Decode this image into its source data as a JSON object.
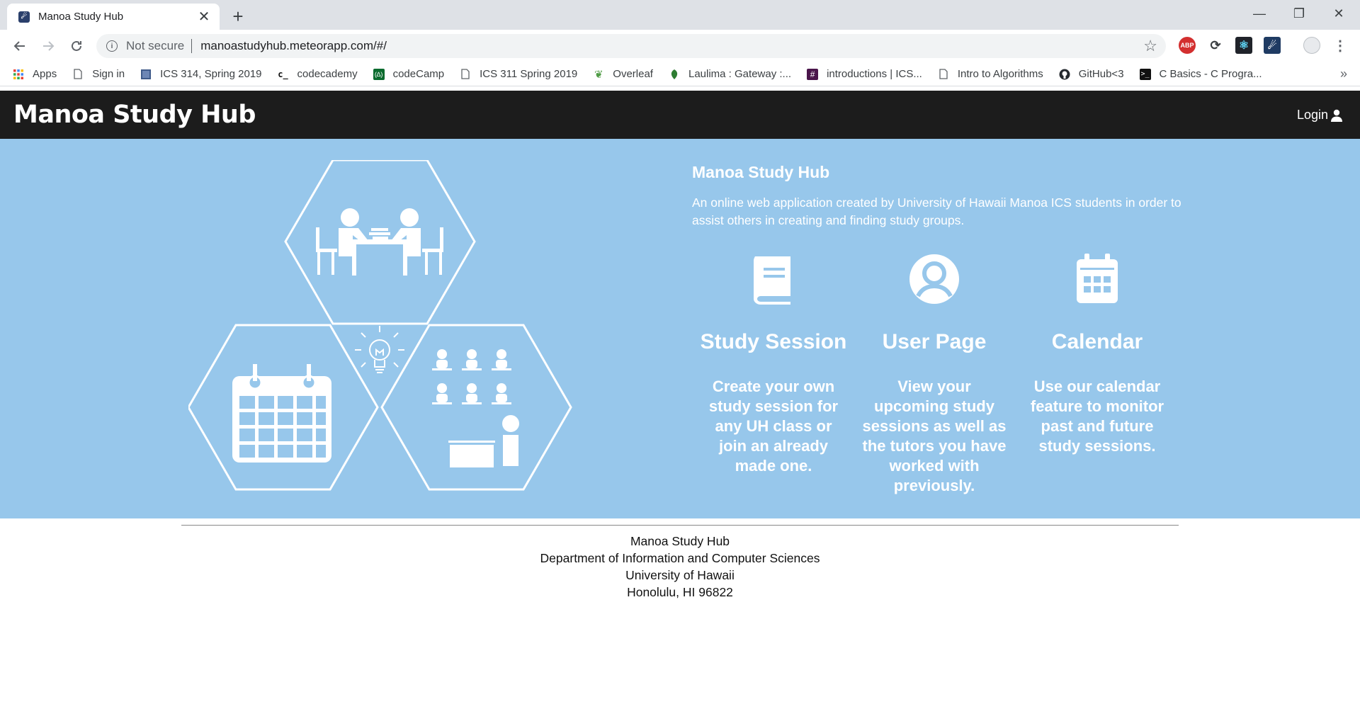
{
  "browser": {
    "tab_title": "Manoa Study Hub",
    "new_tab": "+",
    "close": "✕",
    "minimize": "—",
    "restore": "❐",
    "window_close": "✕",
    "security_label": "Not secure",
    "url": "manoastudyhub.meteorapp.com/#/",
    "bookmarks": [
      {
        "label": "Apps",
        "icon": "apps-grid-icon"
      },
      {
        "label": "Sign in",
        "icon": "page-icon"
      },
      {
        "label": "ICS 314, Spring 2019",
        "icon": "square-icon"
      },
      {
        "label": "codecademy",
        "icon": "codecademy-icon"
      },
      {
        "label": "codeCamp",
        "icon": "codecamp-icon"
      },
      {
        "label": "ICS 311 Spring 2019",
        "icon": "page-icon"
      },
      {
        "label": "Overleaf",
        "icon": "overleaf-icon"
      },
      {
        "label": "Laulima : Gateway :...",
        "icon": "leaf-icon"
      },
      {
        "label": "introductions | ICS...",
        "icon": "slack-icon"
      },
      {
        "label": "Intro to Algorithms",
        "icon": "page-icon"
      },
      {
        "label": "GitHub<3",
        "icon": "github-icon"
      },
      {
        "label": "C Basics - C Progra...",
        "icon": "terminal-icon"
      }
    ],
    "bookmarks_more": "»"
  },
  "site": {
    "brand": "Manoa Study Hub",
    "login": "Login"
  },
  "hero": {
    "title": "Manoa Study Hub",
    "description": "An online web application created by University of Hawaii Manoa ICS students in order to assist others in creating and finding study groups.",
    "features": [
      {
        "title": "Study Session",
        "text": "Create your own study session for any UH class or join an already made one.",
        "icon": "book-icon"
      },
      {
        "title": "User Page",
        "text": "View your upcoming study sessions as well as the tutors you have worked with previously.",
        "icon": "user-circle-icon"
      },
      {
        "title": "Calendar",
        "text": "Use our calendar feature to monitor past and future study sessions.",
        "icon": "calendar-icon"
      }
    ]
  },
  "footer": {
    "line1": "Manoa Study Hub",
    "line2": "Department of Information and Computer Sciences",
    "line3": "University of Hawaii",
    "line4": "Honolulu, HI 96822"
  },
  "colors": {
    "navbar": "#1c1c1c",
    "hero_bg": "#97c7eb",
    "text_light": "#ffffff"
  }
}
